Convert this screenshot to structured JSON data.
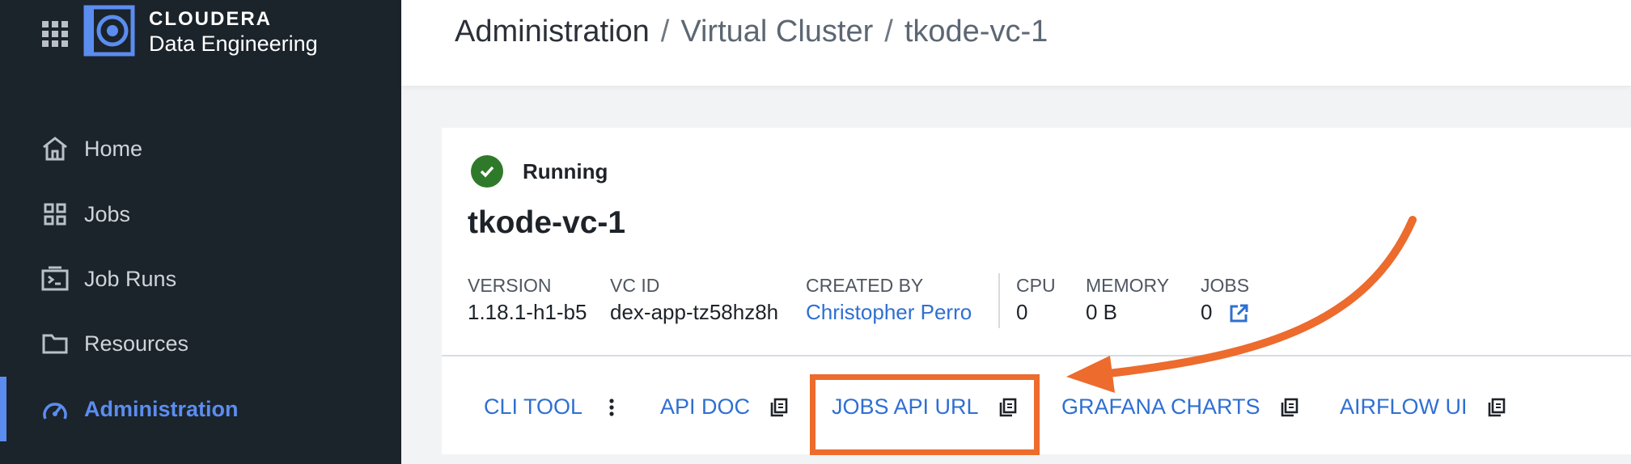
{
  "app": {
    "brand_line1": "CLOUDERA",
    "brand_line2": "Data Engineering"
  },
  "sidebar": {
    "items": [
      {
        "label": "Home",
        "icon": "home-icon"
      },
      {
        "label": "Jobs",
        "icon": "jobs-grid-icon"
      },
      {
        "label": "Job Runs",
        "icon": "terminal-icon"
      },
      {
        "label": "Resources",
        "icon": "folder-icon"
      },
      {
        "label": "Administration",
        "icon": "gauge-icon",
        "active": true
      }
    ]
  },
  "breadcrumb": {
    "items": [
      "Administration",
      "Virtual Cluster",
      "tkode-vc-1"
    ],
    "separator": "/"
  },
  "cluster": {
    "status": "Running",
    "name": "tkode-vc-1",
    "meta": [
      {
        "key": "VERSION",
        "value": "1.18.1-h1-b5"
      },
      {
        "key": "VC ID",
        "value": "dex-app-tz58hz8h"
      },
      {
        "key": "CREATED BY",
        "value": "Christopher Perro"
      },
      {
        "key": "CPU",
        "value": "0"
      },
      {
        "key": "MEMORY",
        "value": "0 B"
      },
      {
        "key": "JOBS",
        "value": "0"
      }
    ]
  },
  "actions": {
    "cli_tool": "CLI TOOL",
    "api_doc": "API DOC",
    "jobs_api_url": "JOBS API URL",
    "grafana_charts": "GRAFANA CHARTS",
    "airflow_ui": "AIRFLOW UI"
  },
  "colors": {
    "sidebar_bg": "#1b232b",
    "accent": "#5b8def",
    "link": "#2f6fd1",
    "status_ok": "#2f7a2a",
    "annotation": "#ec6b2d"
  }
}
